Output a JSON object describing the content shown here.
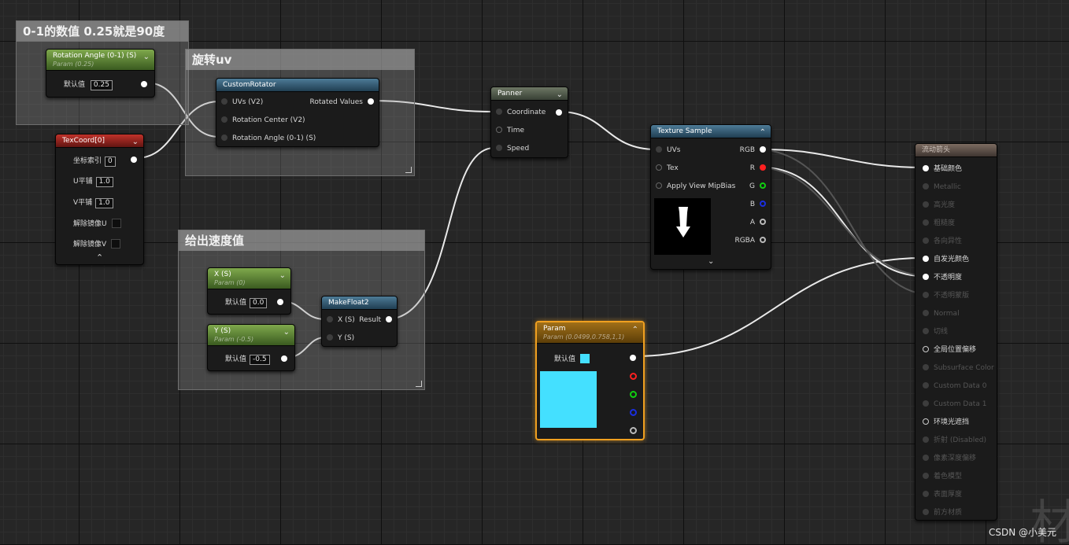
{
  "comments": {
    "c1": "0-1的数值 0.25就是90度",
    "c2": "旋转uv",
    "c3": "给出速度值"
  },
  "rotation_node": {
    "title": "Rotation Angle (0-1) (S)",
    "subtitle": "Param (0.25)",
    "default_label": "默认值",
    "default_value": "0.25"
  },
  "custom_rotator": {
    "title": "CustomRotator",
    "in1": "UVs (V2)",
    "in2": "Rotation Center (V2)",
    "in3": "Rotation Angle (0-1) (S)",
    "out1": "Rotated Values"
  },
  "texcoord": {
    "title": "TexCoord[0]",
    "index_label": "坐标索引",
    "index_value": "0",
    "u_label": "U平铺",
    "u_value": "1.0",
    "v_label": "V平铺",
    "v_value": "1.0",
    "mirror_u": "解除镜像U",
    "mirror_v": "解除镜像V"
  },
  "panner": {
    "title": "Panner",
    "in1": "Coordinate",
    "in2": "Time",
    "in3": "Speed"
  },
  "texture_sample": {
    "title": "Texture Sample",
    "in1": "UVs",
    "in2": "Tex",
    "in3": "Apply View MipBias",
    "out1": "RGB",
    "out2": "R",
    "out3": "G",
    "out4": "B",
    "out5": "A",
    "out6": "RGBA"
  },
  "x_node": {
    "title": "X (S)",
    "subtitle": "Param (0)",
    "default_label": "默认值",
    "default_value": "0.0"
  },
  "y_node": {
    "title": "Y (S)",
    "subtitle": "Param (-0.5)",
    "default_label": "默认值",
    "default_value": "-0.5"
  },
  "makefloat2": {
    "title": "MakeFloat2",
    "in1": "X (S)",
    "in2": "Y (S)",
    "out1": "Result"
  },
  "param_node": {
    "title": "Param",
    "subtitle": "Param (0.0499,0.758,1,1)",
    "default_label": "默认值",
    "swatch_color": "#44e0ff"
  },
  "material": {
    "title": "流动箭头",
    "pins": [
      "基础颜色",
      "Metallic",
      "高光度",
      "粗糙度",
      "各向异性",
      "自发光颜色",
      "不透明度",
      "不透明蒙版",
      "Normal",
      "切线",
      "全局位置偏移",
      "Subsurface Color",
      "Custom Data 0",
      "Custom Data 1",
      "环境光遮挡",
      "折射 (Disabled)",
      "像素深度偏移",
      "着色模型",
      "表面厚度",
      "前方材质"
    ]
  },
  "watermark": "CSDN @小美元"
}
